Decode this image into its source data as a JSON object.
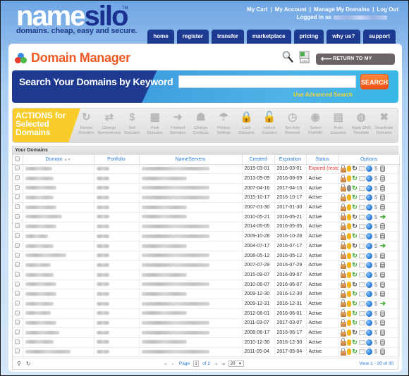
{
  "logo": {
    "name": "name",
    "silo": "silo",
    "tm": "TM",
    "tagline": "domains. cheap, easy and secure."
  },
  "toplinks": [
    "My Cart",
    "My Account",
    "Manage My Domains",
    "Log Out"
  ],
  "logged_in_label": "Logged in as",
  "nav": [
    "home",
    "register",
    "transfer",
    "marketplace",
    "pricing",
    "why us?",
    "support"
  ],
  "page_title": "Domain Manager",
  "return_button": "RETURN TO MY ACCOUNT",
  "search": {
    "label": "Search Your Domains by Keyword",
    "value": "",
    "placeholder": "",
    "button": "SEARCH",
    "advanced_link": "Use Advanced Search"
  },
  "actions": {
    "label_lines": [
      "ACTIONS for",
      "Selected",
      "Domains"
    ],
    "items": [
      {
        "icon": "renew-icon",
        "glyph": "↻",
        "label": [
          "Renew",
          "Domains"
        ]
      },
      {
        "icon": "change-nameservers-icon",
        "glyph": "⇄",
        "label": [
          "Change",
          "Nameservers"
        ]
      },
      {
        "icon": "sell-icon",
        "glyph": "$",
        "label": [
          "Sell",
          "Domains"
        ]
      },
      {
        "icon": "park-icon",
        "glyph": "▦",
        "label": [
          "Park",
          "Domains"
        ]
      },
      {
        "icon": "forward-icon",
        "glyph": "➜",
        "label": [
          "Forward",
          "Domains"
        ]
      },
      {
        "icon": "contacts-icon",
        "glyph": "☗",
        "label": [
          "Change",
          "Contacts"
        ]
      },
      {
        "icon": "privacy-icon",
        "glyph": "☂",
        "label": [
          "Privacy",
          "Settings"
        ]
      },
      {
        "icon": "lock-icon",
        "glyph": "🔒",
        "label": [
          "Lock",
          "Domains"
        ]
      },
      {
        "icon": "unlock-icon",
        "glyph": "🔓",
        "label": [
          "Unlock",
          "Domains"
        ]
      },
      {
        "icon": "auto-renew-icon",
        "glyph": "◷",
        "label": [
          "Set Auto",
          "Renewal"
        ]
      },
      {
        "icon": "portfolio-icon",
        "glyph": "◉",
        "label": [
          "Select",
          "Portfolio"
        ]
      },
      {
        "icon": "push-icon",
        "glyph": "▤",
        "label": [
          "Push",
          "Domains"
        ]
      },
      {
        "icon": "dns-template-icon",
        "glyph": "◍",
        "label": [
          "Apply DNS",
          "Template"
        ]
      },
      {
        "icon": "deactivate-icon",
        "glyph": "✖",
        "label": [
          "Deactivate",
          "Domains"
        ]
      }
    ]
  },
  "grid": {
    "caption": "Your Domains",
    "columns": [
      "Domain",
      "Portfolio",
      "NameServers",
      "Created",
      "Expiration",
      "Status",
      "Options"
    ],
    "sort_indicator": "▲▼",
    "rows": [
      {
        "created": "2015-03-01",
        "expiration": "2016-03-01",
        "status": "Expired (restor",
        "expired": true,
        "privacy": "yellow",
        "renew": "gray",
        "last": "db"
      },
      {
        "created": "2013-09-09",
        "expiration": "2016-09-09",
        "status": "Active",
        "privacy": "yellow",
        "renew": "green",
        "last": "db"
      },
      {
        "created": "2007-04-16",
        "expiration": "2017-04-15",
        "status": "Active",
        "privacy": "gray",
        "renew": "green",
        "last": "db"
      },
      {
        "created": "2015-10-17",
        "expiration": "2016-10-17",
        "status": "Active",
        "privacy": "yellow",
        "renew": "green",
        "last": "db"
      },
      {
        "created": "2007-01-30",
        "expiration": "2017-01-30",
        "status": "Active",
        "privacy": "yellow",
        "renew": "green",
        "last": "db"
      },
      {
        "created": "2010-05-21",
        "expiration": "2016-05-21",
        "status": "Active",
        "privacy": "yellow",
        "renew": "gray",
        "last": "arrow"
      },
      {
        "created": "2014-05-05",
        "expiration": "2016-05-05",
        "status": "Active",
        "privacy": "yellow",
        "renew": "gray",
        "last": "db"
      },
      {
        "created": "2009-10-28",
        "expiration": "2016-10-28",
        "status": "Active",
        "privacy": "yellow",
        "renew": "green",
        "last": "db"
      },
      {
        "created": "2004-07-17",
        "expiration": "2016-07-17",
        "status": "Active",
        "privacy": "yellow",
        "renew": "gray",
        "last": "arrow"
      },
      {
        "created": "2008-05-12",
        "expiration": "2016-05-12",
        "status": "Active",
        "privacy": "yellow",
        "renew": "green",
        "last": "db"
      },
      {
        "created": "2007-07-29",
        "expiration": "2016-07-29",
        "status": "Active",
        "privacy": "yellow",
        "renew": "green",
        "last": "db"
      },
      {
        "created": "2015-09-07",
        "expiration": "2016-09-07",
        "status": "Active",
        "privacy": "yellow",
        "renew": "green",
        "last": "db"
      },
      {
        "created": "2010-06-07",
        "expiration": "2016-06-07",
        "status": "Active",
        "privacy": "yellow",
        "renew": "gray",
        "last": "db"
      },
      {
        "created": "2009-12-30",
        "expiration": "2016-12-30",
        "status": "Active",
        "privacy": "yellow",
        "renew": "green",
        "last": "db"
      },
      {
        "created": "2009-12-31",
        "expiration": "2016-12-31",
        "status": "Active",
        "privacy": "yellow",
        "renew": "green",
        "last": "arrow"
      },
      {
        "created": "2012-06-01",
        "expiration": "2016-06-01",
        "status": "Active",
        "privacy": "yellow",
        "renew": "green",
        "last": "db"
      },
      {
        "created": "2011-03-07",
        "expiration": "2017-03-07",
        "status": "Active",
        "privacy": "yellow",
        "renew": "green",
        "last": "db"
      },
      {
        "created": "2008-06-17",
        "expiration": "2016-06-17",
        "status": "Active",
        "privacy": "yellow",
        "renew": "gray",
        "last": "db"
      },
      {
        "created": "2010-12-30",
        "expiration": "2016-12-30",
        "status": "Active",
        "privacy": "yellow",
        "renew": "green",
        "last": "db"
      },
      {
        "created": "2011-05-04",
        "expiration": "2017-05-04",
        "status": "Active",
        "privacy": "yellow",
        "renew": "green",
        "last": "db"
      }
    ]
  },
  "pager": {
    "page_label": "Page",
    "page": "1",
    "of_label": "of 2",
    "page_size": "20",
    "view_text": "View 1 - 20 of 30"
  },
  "colors": {
    "brand_blue": "#1c3a8f",
    "title_orange": "#ef5a24",
    "search_orange": "#f04f12",
    "actions_yellow": "#f8cd2b",
    "link_blue": "#2a7ad5",
    "expired_red": "#e8312c",
    "advanced_link_yellow": "#f5d43b"
  }
}
